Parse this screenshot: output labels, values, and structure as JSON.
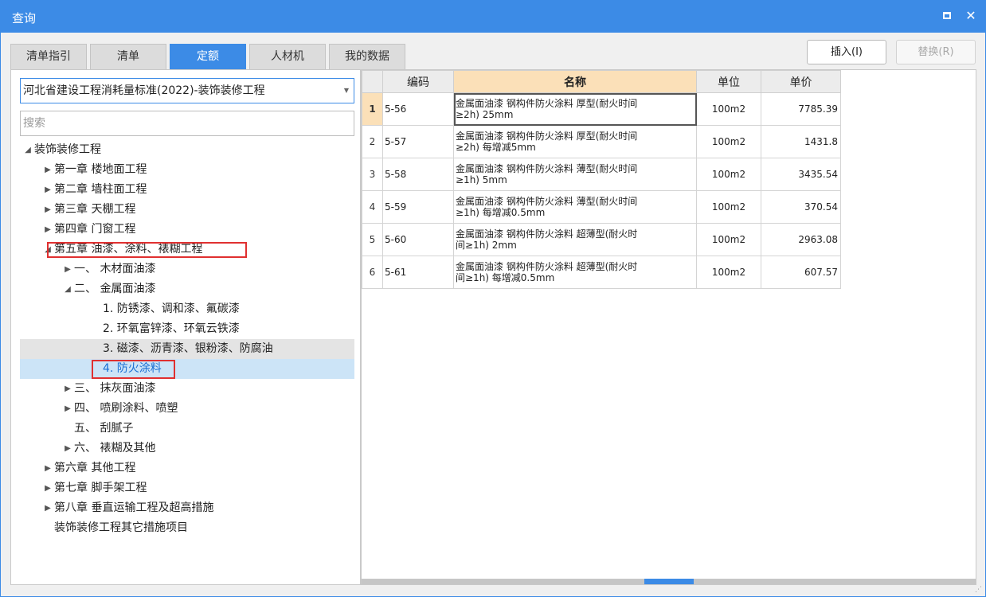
{
  "window": {
    "title": "查询"
  },
  "tabs": [
    {
      "label": "清单指引"
    },
    {
      "label": "清单"
    },
    {
      "label": "定额"
    },
    {
      "label": "人材机"
    },
    {
      "label": "我的数据"
    }
  ],
  "toolbar": {
    "insert_label": "插入(I)",
    "replace_label": "替换(R)"
  },
  "left": {
    "library": "河北省建设工程消耗量标准(2022)-装饰装修工程",
    "search_placeholder": "搜索",
    "tree": [
      {
        "label": "装饰装修工程",
        "toggle": "◢"
      },
      {
        "label": "第一章 楼地面工程",
        "toggle": "▶"
      },
      {
        "label": "第二章 墙柱面工程",
        "toggle": "▶"
      },
      {
        "label": "第三章 天棚工程",
        "toggle": "▶"
      },
      {
        "label": "第四章 门窗工程",
        "toggle": "▶"
      },
      {
        "label": "第五章 油漆、涂料、裱糊工程",
        "toggle": "◢"
      },
      {
        "label": "一、 木材面油漆",
        "toggle": "▶"
      },
      {
        "label": "二、 金属面油漆",
        "toggle": "◢"
      },
      {
        "label": "1. 防锈漆、调和漆、氟碳漆",
        "toggle": ""
      },
      {
        "label": "2. 环氧富锌漆、环氧云铁漆",
        "toggle": ""
      },
      {
        "label": "3. 磁漆、沥青漆、银粉漆、防腐油",
        "toggle": ""
      },
      {
        "label": "4. 防火涂料",
        "toggle": ""
      },
      {
        "label": "三、 抹灰面油漆",
        "toggle": "▶"
      },
      {
        "label": "四、 喷刷涂料、喷塑",
        "toggle": "▶"
      },
      {
        "label": "五、 刮腻子",
        "toggle": ""
      },
      {
        "label": "六、 裱糊及其他",
        "toggle": "▶"
      },
      {
        "label": "第六章 其他工程",
        "toggle": "▶"
      },
      {
        "label": "第七章 脚手架工程",
        "toggle": "▶"
      },
      {
        "label": "第八章 垂直运输工程及超高措施",
        "toggle": "▶"
      },
      {
        "label": "装饰装修工程其它措施项目",
        "toggle": ""
      }
    ]
  },
  "grid": {
    "headers": {
      "code": "编码",
      "name": "名称",
      "unit": "单位",
      "price": "单价"
    },
    "rows": [
      {
        "no": "1",
        "code": "5-56",
        "name1": "金属面油漆 钢构件防火涂料 厚型(耐火时间",
        "name2": "≥2h) 25mm",
        "unit": "100m2",
        "price": "7785.39"
      },
      {
        "no": "2",
        "code": "5-57",
        "name1": "金属面油漆 钢构件防火涂料 厚型(耐火时间",
        "name2": "≥2h) 每增减5mm",
        "unit": "100m2",
        "price": "1431.8"
      },
      {
        "no": "3",
        "code": "5-58",
        "name1": "金属面油漆 钢构件防火涂料 薄型(耐火时间",
        "name2": "≥1h) 5mm",
        "unit": "100m2",
        "price": "3435.54"
      },
      {
        "no": "4",
        "code": "5-59",
        "name1": "金属面油漆 钢构件防火涂料 薄型(耐火时间",
        "name2": "≥1h) 每增减0.5mm",
        "unit": "100m2",
        "price": "370.54"
      },
      {
        "no": "5",
        "code": "5-60",
        "name1": "金属面油漆 钢构件防火涂料 超薄型(耐火时",
        "name2": "间≥1h) 2mm",
        "unit": "100m2",
        "price": "2963.08"
      },
      {
        "no": "6",
        "code": "5-61",
        "name1": "金属面油漆 钢构件防火涂料 超薄型(耐火时",
        "name2": "间≥1h) 每增减0.5mm",
        "unit": "100m2",
        "price": "607.57"
      }
    ]
  },
  "colors": {
    "accent": "#3c8be6",
    "highlight_header": "#fbe0b8",
    "annotation": "#e03030"
  }
}
